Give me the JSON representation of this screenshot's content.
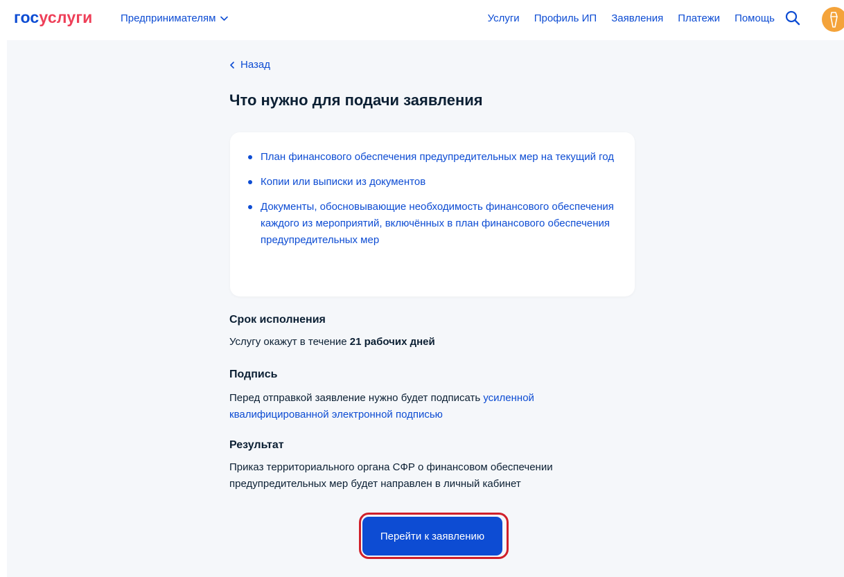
{
  "header": {
    "logo": {
      "part1": "гос",
      "part2": "услуги"
    },
    "segment_label": "Предпринимателям",
    "nav": [
      {
        "id": "services",
        "label": "Услуги"
      },
      {
        "id": "profile",
        "label": "Профиль ИП"
      },
      {
        "id": "applications",
        "label": "Заявления"
      },
      {
        "id": "payments",
        "label": "Платежи"
      },
      {
        "id": "help",
        "label": "Помощь"
      }
    ],
    "icons": {
      "search": "search-icon",
      "avatar": "avatar-icon",
      "segment_chevron": "chevron-down-icon"
    }
  },
  "back_label": "Назад",
  "page_title": "Что нужно для подачи заявления",
  "requirements": [
    "План финансового обеспечения предупредительных мер на текущий год",
    "Копии или выписки из документов",
    "Документы, обосновывающие необходимость финансового обеспечения каждого из мероприятий, включённых в план финансового обеспечения предупредительных мер"
  ],
  "deadline": {
    "title": "Срок исполнения",
    "text_prefix": "Услугу окажут в течение ",
    "text_bold": "21 рабочих дней"
  },
  "signature": {
    "title": "Подпись",
    "text_prefix": "Перед отправкой заявление нужно будет подписать ",
    "text_link": "усиленной квалифицированной электронной подписью"
  },
  "result": {
    "title": "Результат",
    "text": "Приказ территориального органа СФР о финансовом обеспечении предупредительных мер будет направлен в личный кабинет"
  },
  "cta_label": "Перейти к заявлению",
  "colors": {
    "brand_blue": "#0d4cd3",
    "brand_red": "#ee3f58",
    "text": "#0b1f33",
    "page_bg": "#f5f7fa",
    "highlight_border": "#d0202a"
  }
}
